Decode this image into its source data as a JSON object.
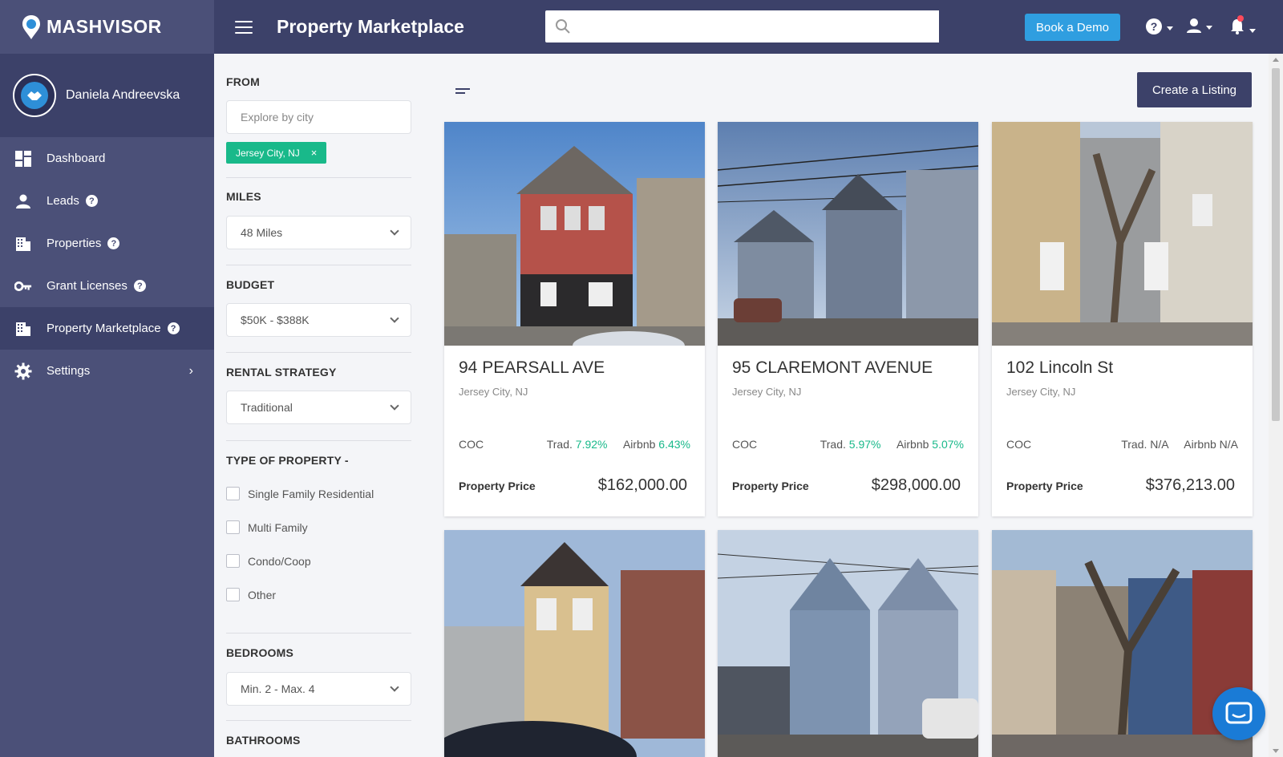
{
  "brand": {
    "name": "MASHVISOR"
  },
  "header": {
    "title": "Property Marketplace",
    "search_placeholder": "",
    "demo_label": "Book a Demo"
  },
  "user": {
    "name": "Daniela Andreevska"
  },
  "sidebar": {
    "items": [
      {
        "label": "Dashboard",
        "icon": "dashboard-icon",
        "help": false
      },
      {
        "label": "Leads",
        "icon": "person-icon",
        "help": true
      },
      {
        "label": "Properties",
        "icon": "building-icon",
        "help": true
      },
      {
        "label": "Grant Licenses",
        "icon": "key-icon",
        "help": true
      },
      {
        "label": "Property Marketplace",
        "icon": "building-icon",
        "help": true,
        "active": true
      },
      {
        "label": "Settings",
        "icon": "gear-icon",
        "help": false,
        "chevron": "›"
      }
    ]
  },
  "filters": {
    "from_label": "FROM",
    "city_placeholder": "Explore by city",
    "chip": "Jersey City, NJ",
    "chip_close": "×",
    "miles_label": "MILES",
    "miles_value": "48 Miles",
    "budget_label": "BUDGET",
    "budget_value": "$50K - $388K",
    "strategy_label": "RENTAL STRATEGY",
    "strategy_value": "Traditional",
    "type_label": "TYPE OF PROPERTY -",
    "types": [
      "Single Family Residential",
      "Multi Family",
      "Condo/Coop",
      "Other"
    ],
    "bedrooms_label": "BEDROOMS",
    "bedrooms_value": "Min. 2 - Max. 4",
    "bathrooms_label": "BATHROOMS"
  },
  "content": {
    "create_label": "Create a Listing",
    "coc_label": "COC",
    "trad_label": "Trad.",
    "airbnb_label": "Airbnb",
    "price_label": "Property Price"
  },
  "listings": [
    {
      "title": "94 PEARSALL AVE",
      "city": "Jersey City, NJ",
      "trad": "7.92%",
      "airbnb": "6.43%",
      "price": "$162,000.00",
      "house_color": "#b5524a"
    },
    {
      "title": "95 CLAREMONT AVENUE",
      "city": "Jersey City, NJ",
      "trad": "5.97%",
      "airbnb": "5.07%",
      "price": "$298,000.00",
      "house_color": "#6f7d93"
    },
    {
      "title": "102 Lincoln St",
      "city": "Jersey City, NJ",
      "trad": "N/A",
      "airbnb": "N/A",
      "price": "$376,213.00",
      "house_color": "#c9b38a"
    },
    {
      "house_color": "#d9c08f"
    },
    {
      "house_color": "#7d93b0"
    },
    {
      "house_color": "#8c8275"
    }
  ]
}
